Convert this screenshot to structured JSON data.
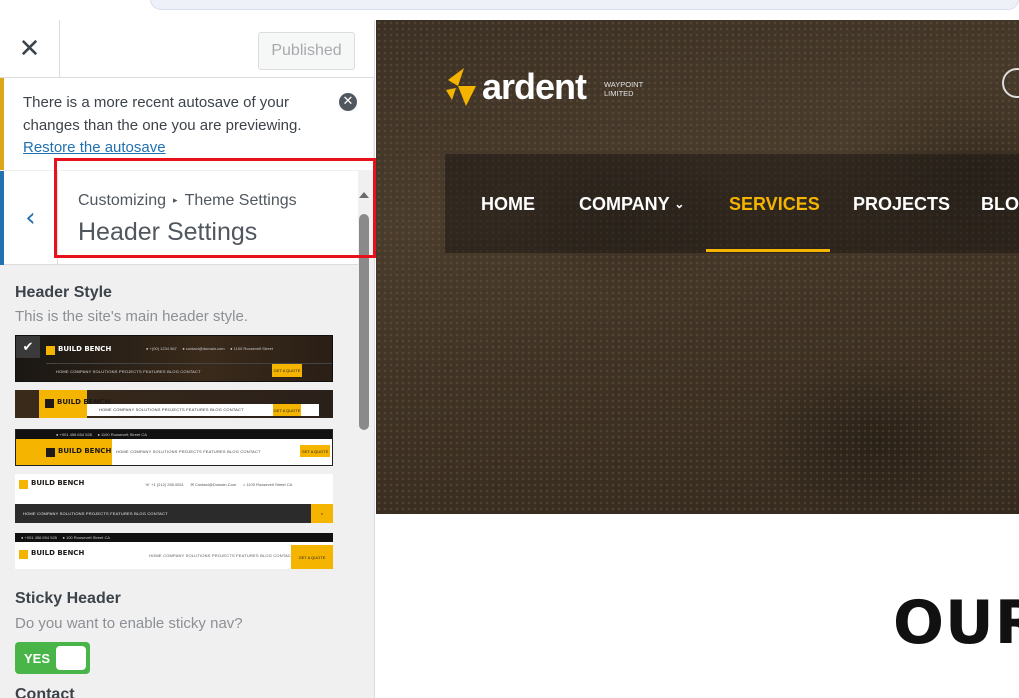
{
  "sidebar": {
    "close_icon": "close-icon",
    "publish_label": "Published",
    "notice": {
      "text": "There is a more recent autosave of your changes than the one you are previewing.",
      "link": "Restore the autosave",
      "dismiss_icon": "dismiss-icon"
    },
    "section": {
      "breadcrumb_root": "Customizing",
      "breadcrumb_sep": "▸",
      "breadcrumb_parent": "Theme Settings",
      "title": "Header Settings",
      "back_icon": "chevron-left-icon"
    },
    "header_style": {
      "title": "Header Style",
      "description": "This is the site's main header style.",
      "selected_index": 0,
      "options": [
        {
          "name": "header-style-1",
          "logo": "BUILD BENCH"
        },
        {
          "name": "header-style-2",
          "logo": "BUILD BENCH"
        },
        {
          "name": "header-style-3",
          "logo": "BUILD BENCH"
        },
        {
          "name": "header-style-4",
          "logo": "BUILD BENCH"
        },
        {
          "name": "header-style-5",
          "logo": "BUILD BENCH"
        }
      ],
      "thumb_nav": "HOME   COMPANY   SOLUTIONS   PROJECTS   FEATURES   BLOG   CONTACT",
      "thumb_btn": "GET A QUOTE"
    },
    "sticky_header": {
      "title": "Sticky Header",
      "description": "Do you want to enable sticky nav?",
      "toggle_label": "YES",
      "enabled": true
    },
    "next_section_partial": "Contact"
  },
  "preview": {
    "logo": {
      "word": "ardent",
      "tagline": "WAYPOINT LIMITED"
    },
    "nav": [
      {
        "label": "HOME",
        "active": false
      },
      {
        "label": "COMPANY",
        "active": false,
        "has_dropdown": true
      },
      {
        "label": "SERVICES",
        "active": true
      },
      {
        "label": "PROJECTS",
        "active": false
      },
      {
        "label": "BLOG",
        "active": false
      }
    ],
    "section_heading": "OUR",
    "colors": {
      "accent": "#f5b400",
      "link": "#2271b1",
      "notice": "#dba617",
      "highlight": "#e8101c",
      "toggle": "#49b549"
    }
  }
}
